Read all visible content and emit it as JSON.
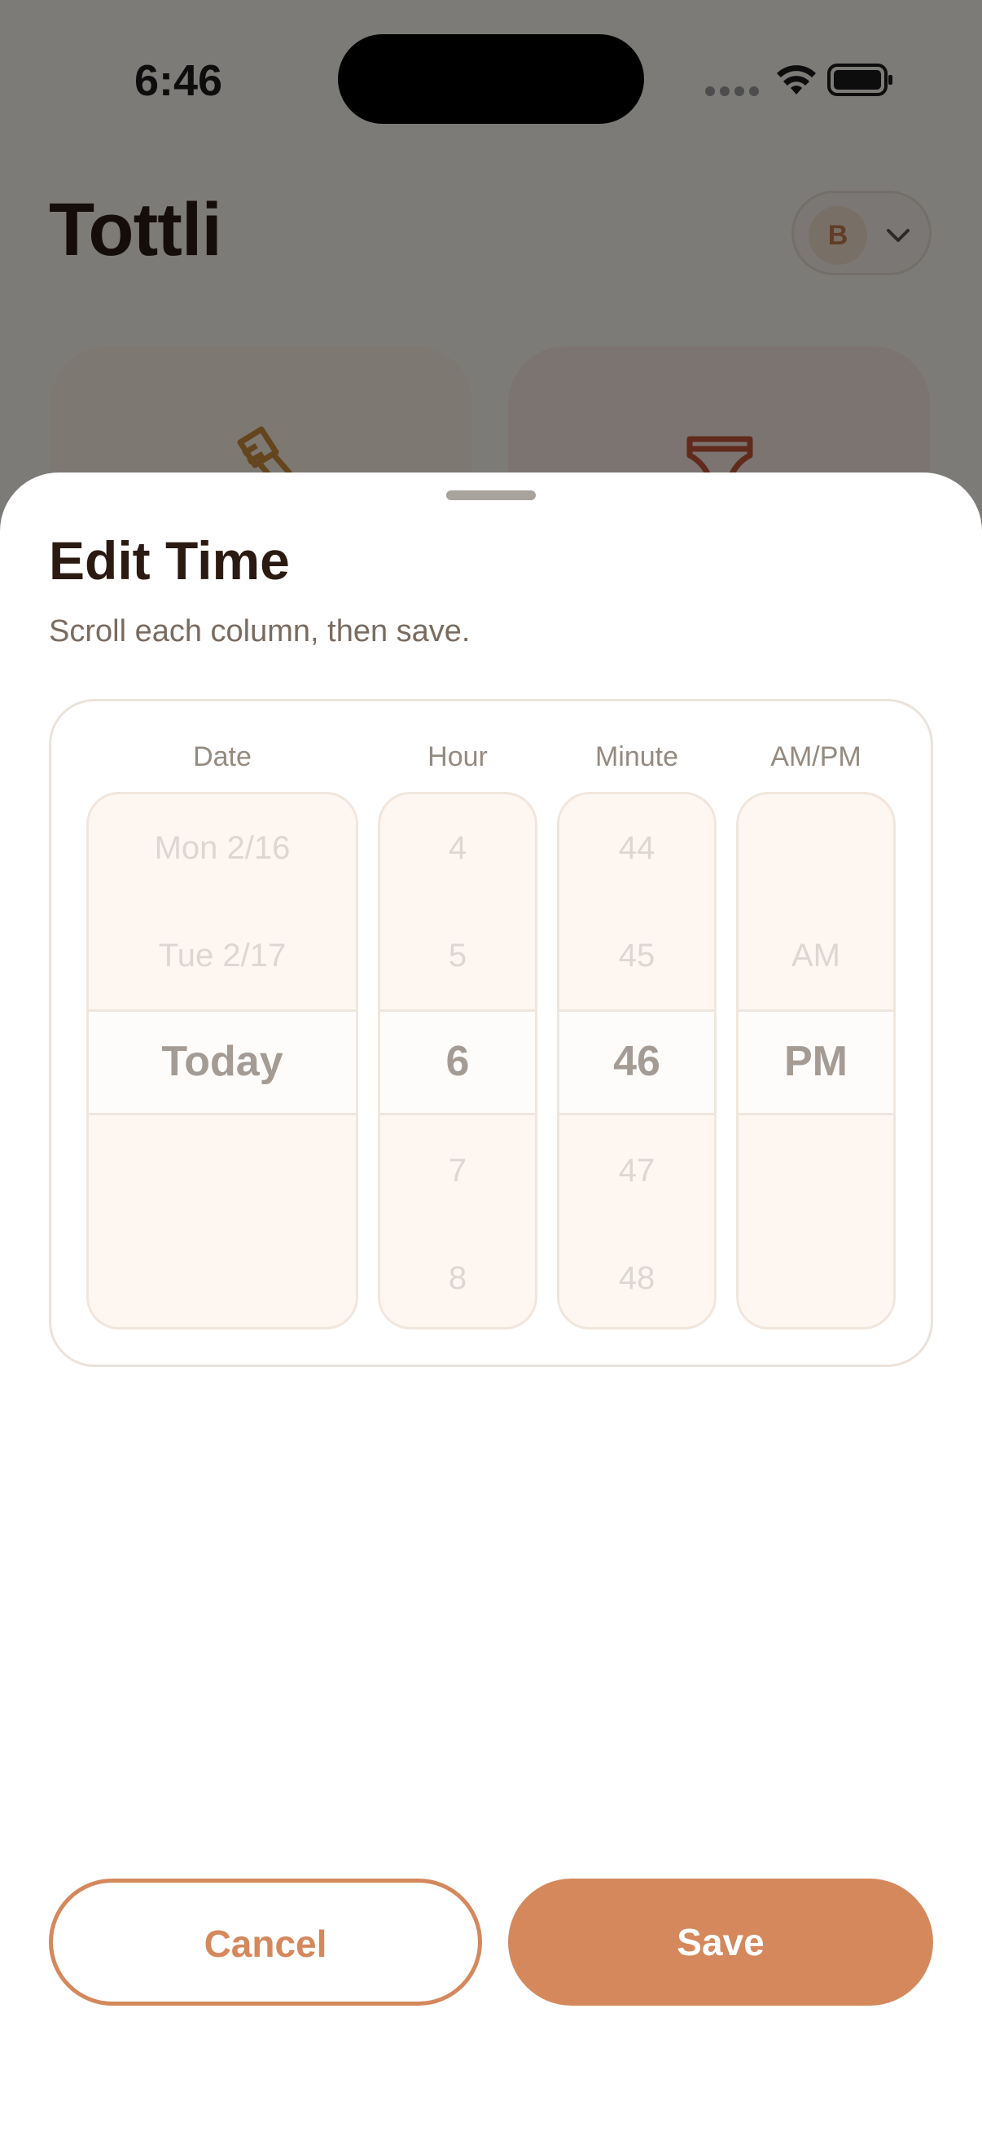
{
  "status_bar": {
    "time": "6:46"
  },
  "app": {
    "title": "Tottli",
    "profile_initial": "B"
  },
  "sheet": {
    "title": "Edit Time",
    "subtitle": "Scroll each column, then save.",
    "columns": {
      "date": {
        "header": "Date",
        "items": [
          "Mon 2/16",
          "Tue 2/17"
        ],
        "selected": "Today"
      },
      "hour": {
        "header": "Hour",
        "items_above": [
          "4",
          "5"
        ],
        "selected": "6",
        "items_below": [
          "7",
          "8"
        ]
      },
      "minute": {
        "header": "Minute",
        "items_above": [
          "44",
          "45"
        ],
        "selected": "46",
        "items_below": [
          "47",
          "48"
        ]
      },
      "ampm": {
        "header": "AM/PM",
        "items_above": [
          "AM"
        ],
        "selected": "PM"
      }
    },
    "cancel_label": "Cancel",
    "save_label": "Save"
  },
  "colors": {
    "accent": "#d4885c",
    "title": "#2a1a12"
  }
}
